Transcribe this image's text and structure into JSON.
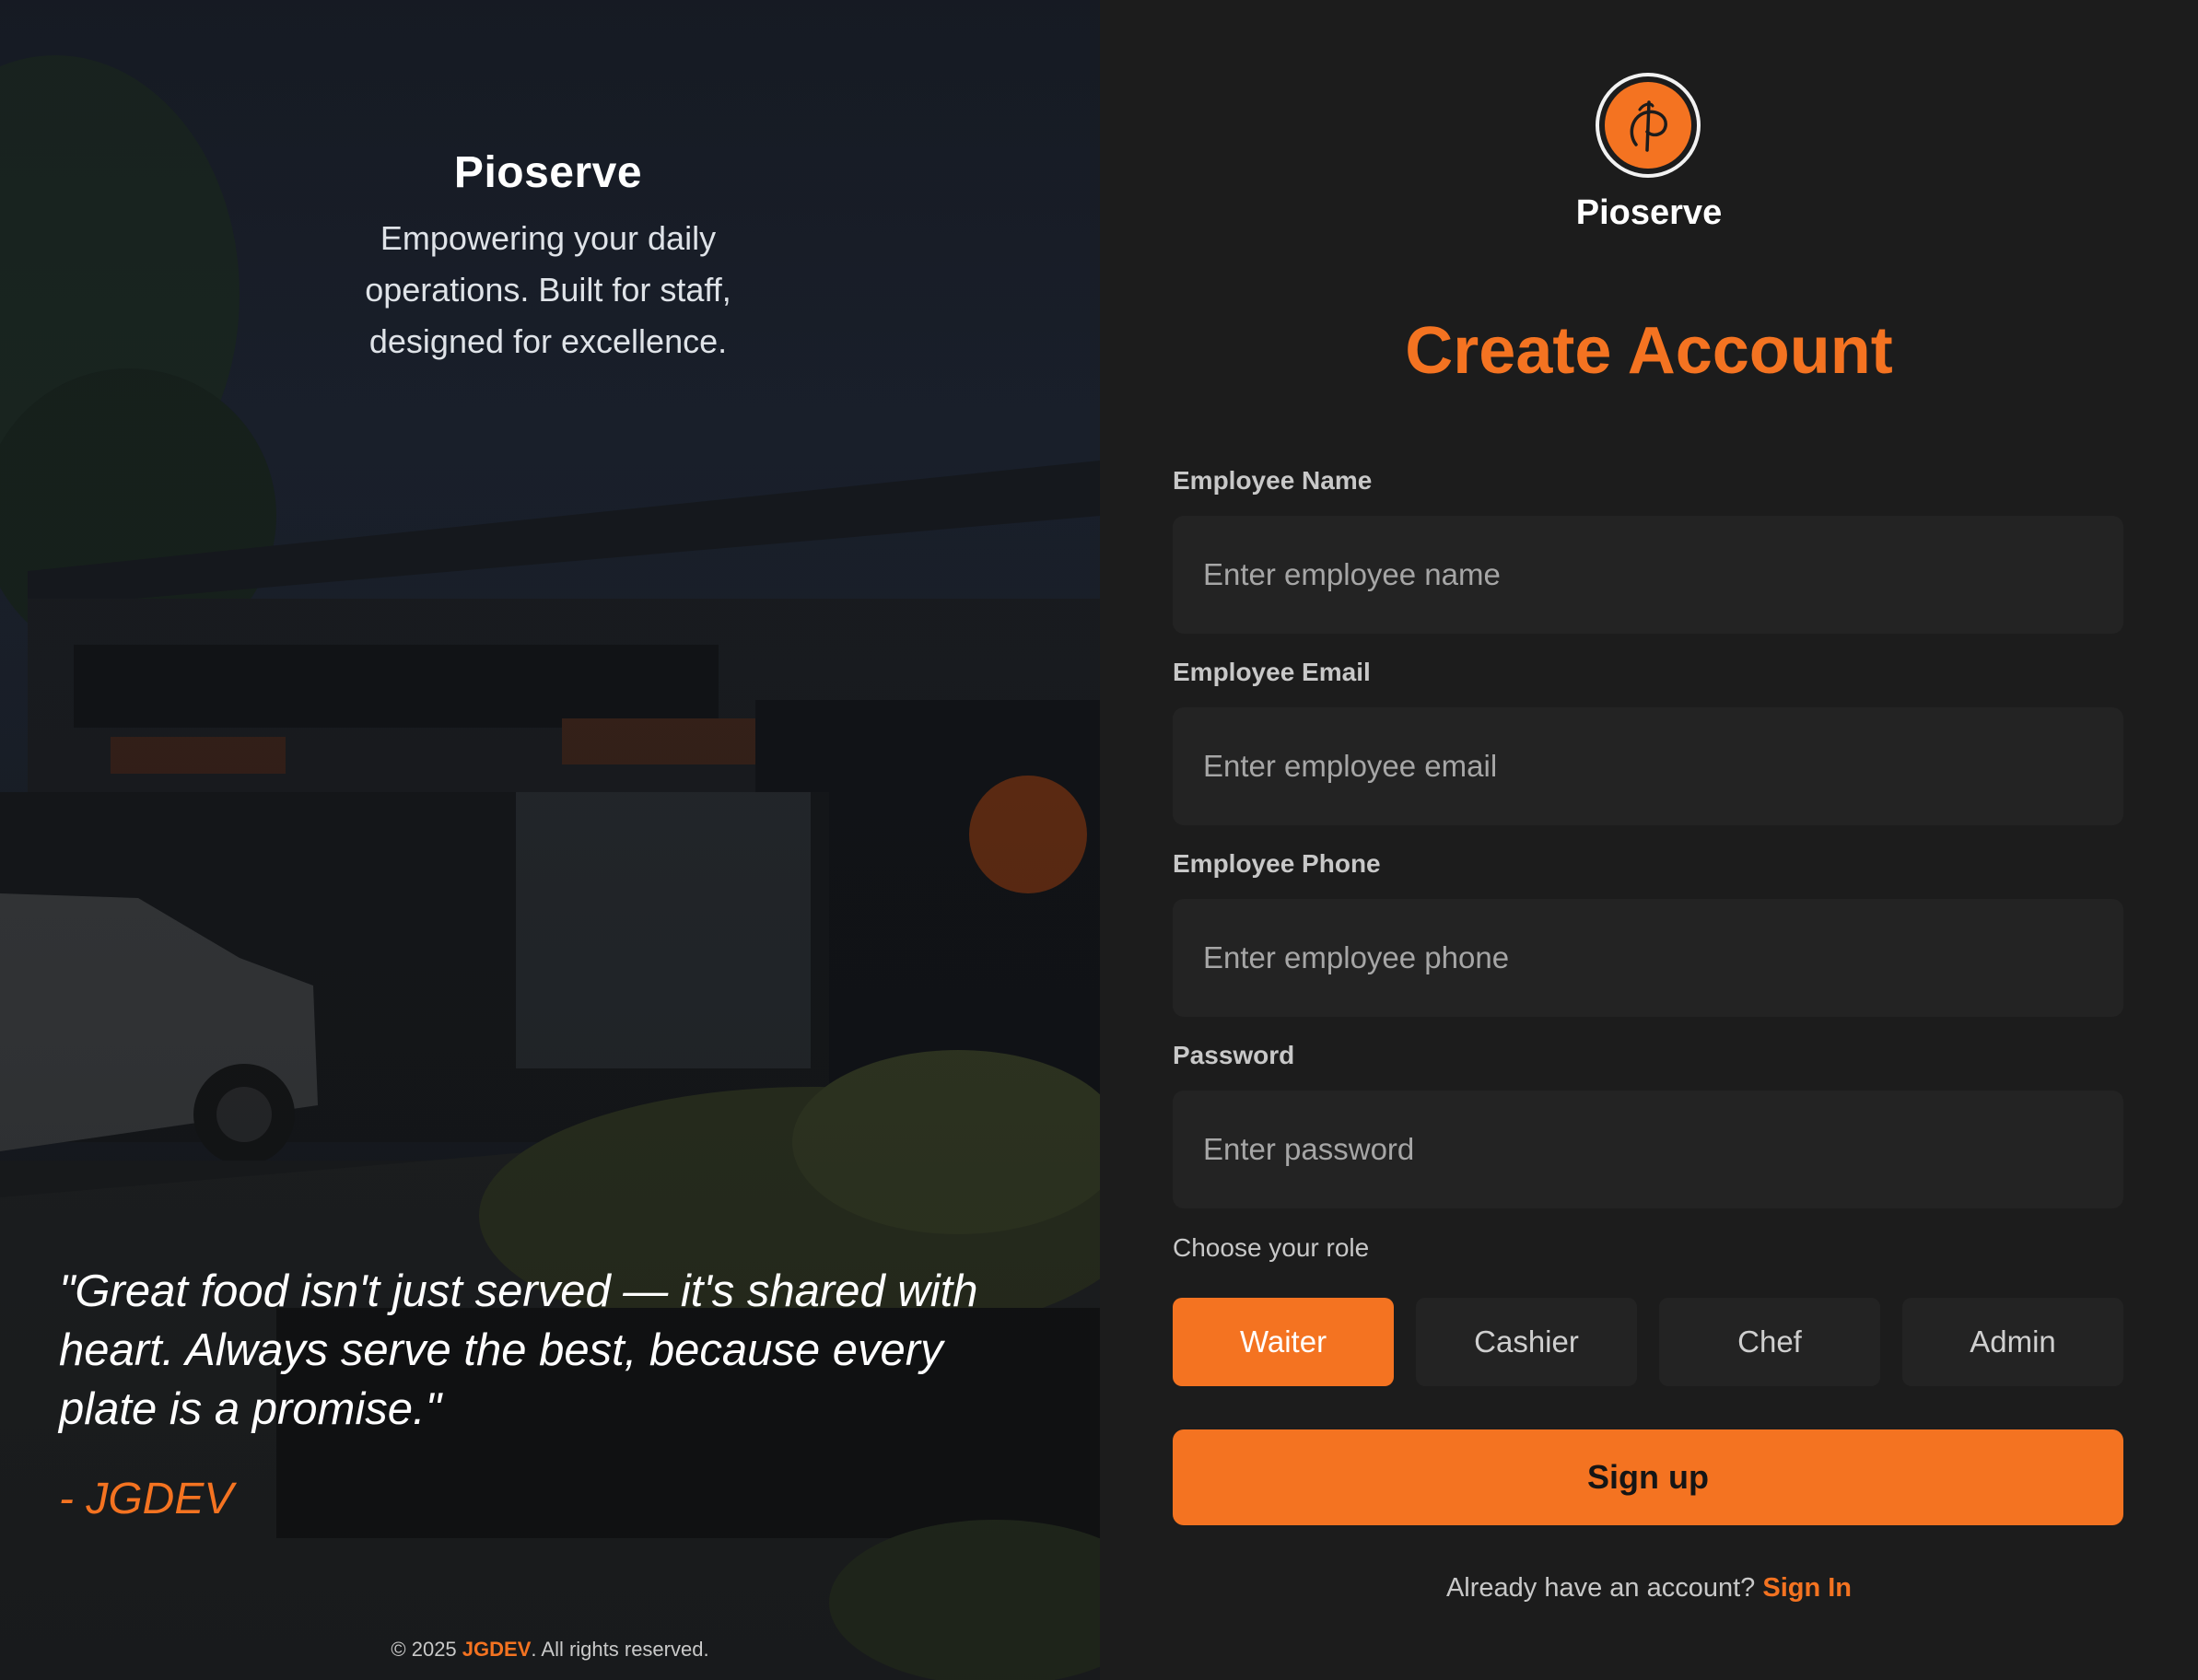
{
  "left": {
    "brand_title": "Pioserve",
    "tagline_line1": "Empowering your daily",
    "tagline_line2": "operations. Built for staff,",
    "tagline_line3": "designed for excellence.",
    "quote_line1": "\"Great food isn't just served — it's shared with",
    "quote_line2": "heart. Always serve the best, because every",
    "quote_line3": "plate is a promise.\"",
    "quote_author": "- JGDEV",
    "footer_prefix": "© 2025 ",
    "footer_brand": "JGDEV",
    "footer_suffix": ". All rights reserved."
  },
  "right": {
    "logo_name": "Pioserve",
    "heading": "Create Account",
    "fields": [
      {
        "label": "Employee Name",
        "placeholder": "Enter employee name"
      },
      {
        "label": "Employee Email",
        "placeholder": "Enter employee email"
      },
      {
        "label": "Employee Phone",
        "placeholder": "Enter employee phone"
      },
      {
        "label": "Password",
        "placeholder": "Enter password"
      }
    ],
    "role_label": "Choose your role",
    "roles": [
      "Waiter",
      "Cashier",
      "Chef",
      "Admin"
    ],
    "selected_role": "Waiter",
    "signup_label": "Sign up",
    "signin_prompt": "Already have an account? ",
    "signin_link": "Sign In"
  },
  "colors": {
    "accent": "#f47321",
    "panel_bg": "#1c1c1c",
    "field_bg": "#232323"
  },
  "icons": {
    "logo": "pioserve-logo-icon"
  }
}
